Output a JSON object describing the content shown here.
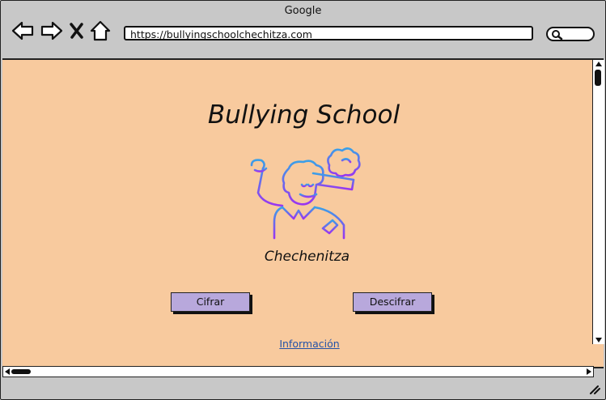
{
  "window": {
    "title": "Google"
  },
  "nav": {
    "icons": [
      "back-icon",
      "forward-icon",
      "close-icon",
      "home-icon"
    ]
  },
  "address": {
    "url": "https://bullyingschoolchechitza.com"
  },
  "page": {
    "title": "Bullying School",
    "subtitle": "Chechenitza",
    "cifrar_label": "Cifrar",
    "descifrar_label": "Descifrar",
    "info_link": "Información"
  },
  "colors": {
    "content_bg": "#f8ca9e",
    "button_bg": "#b8a8dc",
    "link": "#2352a8"
  }
}
